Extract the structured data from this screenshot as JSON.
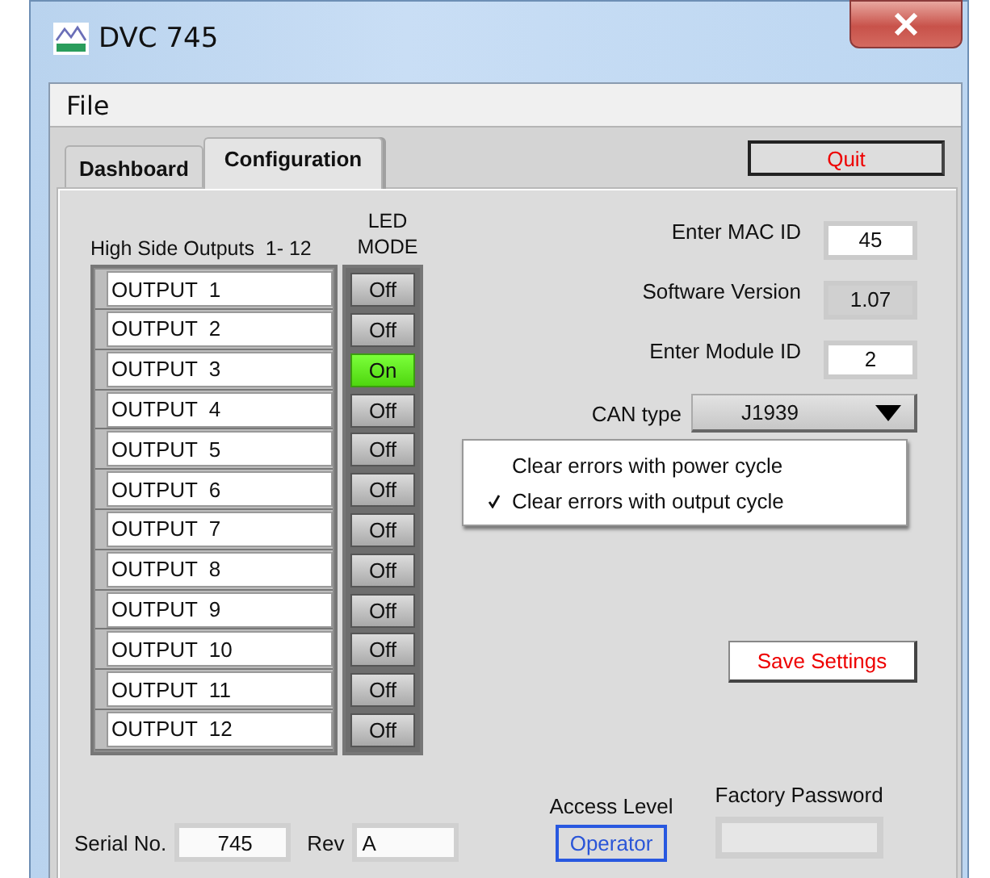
{
  "window": {
    "title": "DVC 745"
  },
  "menu": [
    "File"
  ],
  "tabs": [
    {
      "label": "Dashboard",
      "selected": false
    },
    {
      "label": "Configuration",
      "selected": true
    }
  ],
  "quit_button": "Quit",
  "outputs": {
    "heading": "High Side Outputs  1- 12",
    "led_heading": "LED MODE",
    "rows": [
      {
        "name": "OUTPUT  1",
        "led": "Off",
        "on": false
      },
      {
        "name": "OUTPUT  2",
        "led": "Off",
        "on": false
      },
      {
        "name": "OUTPUT  3",
        "led": "On",
        "on": true
      },
      {
        "name": "OUTPUT  4",
        "led": "Off",
        "on": false
      },
      {
        "name": "OUTPUT  5",
        "led": "Off",
        "on": false
      },
      {
        "name": "OUTPUT  6",
        "led": "Off",
        "on": false
      },
      {
        "name": "OUTPUT  7",
        "led": "Off",
        "on": false
      },
      {
        "name": "OUTPUT  8",
        "led": "Off",
        "on": false
      },
      {
        "name": "OUTPUT  9",
        "led": "Off",
        "on": false
      },
      {
        "name": "OUTPUT  10",
        "led": "Off",
        "on": false
      },
      {
        "name": "OUTPUT  11",
        "led": "Off",
        "on": false
      },
      {
        "name": "OUTPUT  12",
        "led": "Off",
        "on": false
      }
    ]
  },
  "fields": [
    {
      "label": "Enter MAC ID",
      "value": "45",
      "disabled": false
    },
    {
      "label": "Software Version",
      "value": "1.07",
      "disabled": true
    },
    {
      "label": "Enter Module ID",
      "value": "2",
      "disabled": false
    }
  ],
  "can_type": {
    "label": "CAN type",
    "value": "J1939"
  },
  "error_menu": [
    {
      "label": "Clear errors with power cycle",
      "checked": false
    },
    {
      "label": "Clear errors with output cycle",
      "checked": true
    }
  ],
  "save_button": "Save Settings",
  "serial": {
    "label": "Serial No.",
    "value": "745"
  },
  "rev": {
    "label": "Rev",
    "value": "A"
  },
  "access_level": {
    "label": "Access Level",
    "value": "Operator"
  },
  "factory_password": {
    "label": "Factory Password"
  }
}
